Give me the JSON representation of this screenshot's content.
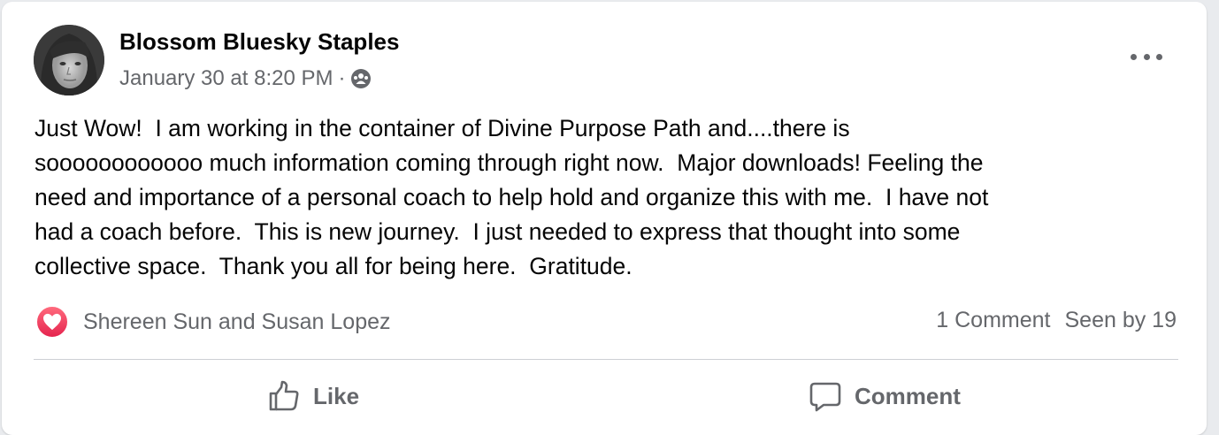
{
  "post": {
    "author": "Blossom Bluesky Staples",
    "timestamp": "January 30 at 8:20 PM",
    "separator": "·",
    "audience_icon": "group-icon",
    "text": "Just Wow!  I am working in the container of Divine Purpose Path and....there is\nsoooooooooooo much information coming through right now.  Major downloads! Feeling the\nneed and importance of a personal coach to help hold and organize this with me.  I have not\nhad a coach before.  This is new journey.  I just needed to express that thought into some\ncollective space.  Thank you all for being here.  Gratitude."
  },
  "reactions": {
    "icon": "heart-icon",
    "names": "Shereen Sun and Susan Lopez",
    "comments": "1 Comment",
    "seen": "Seen by 19"
  },
  "actions": {
    "like_label": "Like",
    "comment_label": "Comment"
  },
  "colors": {
    "text_primary": "#050505",
    "text_secondary": "#65676b",
    "heart_red": "#e5244e",
    "divider": "#ced0d4"
  }
}
